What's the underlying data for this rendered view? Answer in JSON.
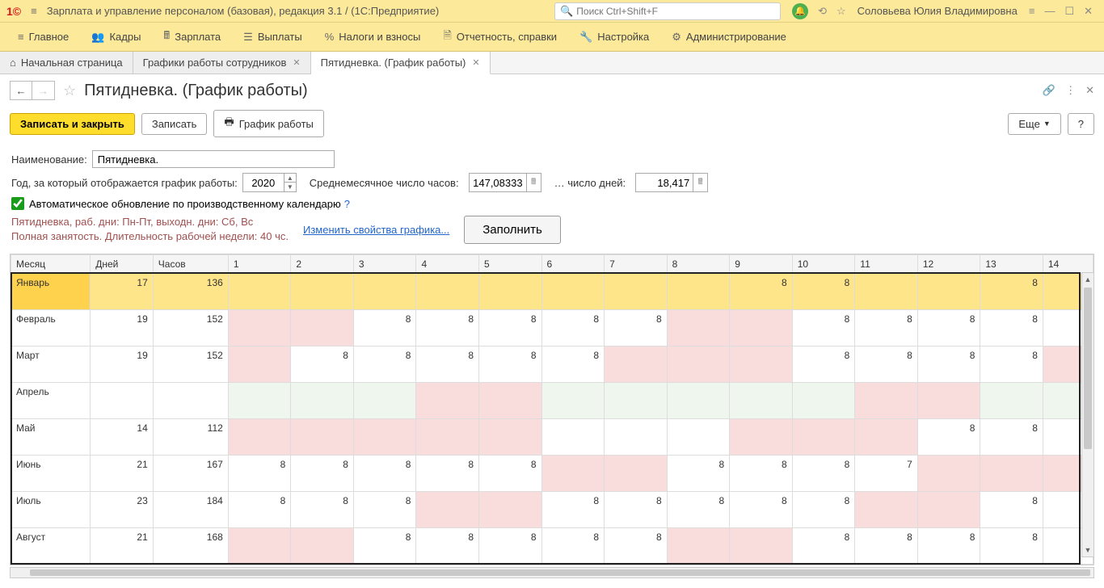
{
  "titlebar": {
    "app_title": "Зарплата и управление персоналом (базовая), редакция 3.1  / (1С:Предприятие)",
    "search_placeholder": "Поиск Ctrl+Shift+F",
    "user": "Соловьева Юлия Владимировна"
  },
  "menu": [
    "Главное",
    "Кадры",
    "Зарплата",
    "Выплаты",
    "Налоги и взносы",
    "Отчетность, справки",
    "Настройка",
    "Администрирование"
  ],
  "tabs": [
    {
      "label": "Начальная страница",
      "closable": false,
      "home": true
    },
    {
      "label": "Графики работы сотрудников",
      "closable": true
    },
    {
      "label": "Пятидневка. (График работы)",
      "closable": true,
      "active": true
    }
  ],
  "page": {
    "title": "Пятидневка. (График работы)",
    "save_close": "Записать и закрыть",
    "save": "Записать",
    "schedule": "График работы",
    "more": "Еще",
    "help": "?",
    "name_label": "Наименование:",
    "name_value": "Пятидневка.",
    "year_label": "Год, за который отображается график работы:",
    "year_value": "2020",
    "avg_hours_label": "Среднемесячное число часов:",
    "avg_hours_value": "147,08333",
    "avg_days_label": "… число дней:",
    "avg_days_value": "18,417",
    "auto_update": "Автоматическое обновление по производственному календарю",
    "info1": "Пятидневка, раб. дни: Пн-Пт, выходн. дни: Сб, Вс",
    "info2": "Полная занятость. Длительность рабочей недели: 40 чс.",
    "change_link": "Изменить свойства графика...",
    "fill": "Заполнить"
  },
  "table": {
    "headers": [
      "Месяц",
      "Дней",
      "Часов",
      "1",
      "2",
      "3",
      "4",
      "5",
      "6",
      "7",
      "8",
      "9",
      "10",
      "11",
      "12",
      "13",
      "14"
    ],
    "rows": [
      {
        "month": "Январь",
        "days": "17",
        "hours": "136",
        "selected": true,
        "cells": [
          {
            "v": "",
            "c": "yel"
          },
          {
            "v": "",
            "c": "yel"
          },
          {
            "v": "",
            "c": "yel"
          },
          {
            "v": "",
            "c": "lightpink"
          },
          {
            "v": "",
            "c": "lightpink"
          },
          {
            "v": "",
            "c": "yel"
          },
          {
            "v": "",
            "c": "yel"
          },
          {
            "v": "",
            "c": "yel"
          },
          {
            "v": "8",
            "c": "yel"
          },
          {
            "v": "8",
            "c": "yel"
          },
          {
            "v": "",
            "c": "lightpink"
          },
          {
            "v": "",
            "c": "lightpink"
          },
          {
            "v": "8",
            "c": "yel"
          },
          {
            "v": "",
            "c": "yel"
          }
        ]
      },
      {
        "month": "Февраль",
        "days": "19",
        "hours": "152",
        "cells": [
          {
            "v": "",
            "c": "pink"
          },
          {
            "v": "",
            "c": "pink"
          },
          {
            "v": "8",
            "c": ""
          },
          {
            "v": "8",
            "c": ""
          },
          {
            "v": "8",
            "c": ""
          },
          {
            "v": "8",
            "c": ""
          },
          {
            "v": "8",
            "c": ""
          },
          {
            "v": "",
            "c": "pink"
          },
          {
            "v": "",
            "c": "pink"
          },
          {
            "v": "8",
            "c": ""
          },
          {
            "v": "8",
            "c": ""
          },
          {
            "v": "8",
            "c": ""
          },
          {
            "v": "8",
            "c": ""
          },
          {
            "v": "",
            "c": ""
          }
        ]
      },
      {
        "month": "Март",
        "days": "19",
        "hours": "152",
        "cells": [
          {
            "v": "",
            "c": "pink"
          },
          {
            "v": "8",
            "c": ""
          },
          {
            "v": "8",
            "c": ""
          },
          {
            "v": "8",
            "c": ""
          },
          {
            "v": "8",
            "c": ""
          },
          {
            "v": "8",
            "c": ""
          },
          {
            "v": "",
            "c": "pink"
          },
          {
            "v": "",
            "c": "pink"
          },
          {
            "v": "",
            "c": "pink"
          },
          {
            "v": "8",
            "c": ""
          },
          {
            "v": "8",
            "c": ""
          },
          {
            "v": "8",
            "c": ""
          },
          {
            "v": "8",
            "c": ""
          },
          {
            "v": "",
            "c": "pink"
          }
        ]
      },
      {
        "month": "Апрель",
        "days": "",
        "hours": "",
        "cells": [
          {
            "v": "",
            "c": "green"
          },
          {
            "v": "",
            "c": "green"
          },
          {
            "v": "",
            "c": "green"
          },
          {
            "v": "",
            "c": "pink"
          },
          {
            "v": "",
            "c": "pink"
          },
          {
            "v": "",
            "c": "green"
          },
          {
            "v": "",
            "c": "green"
          },
          {
            "v": "",
            "c": "green"
          },
          {
            "v": "",
            "c": "green"
          },
          {
            "v": "",
            "c": "green"
          },
          {
            "v": "",
            "c": "pink"
          },
          {
            "v": "",
            "c": "pink"
          },
          {
            "v": "",
            "c": "green"
          },
          {
            "v": "",
            "c": "green"
          }
        ]
      },
      {
        "month": "Май",
        "days": "14",
        "hours": "112",
        "cells": [
          {
            "v": "",
            "c": "pink"
          },
          {
            "v": "",
            "c": "pink"
          },
          {
            "v": "",
            "c": "pink"
          },
          {
            "v": "",
            "c": "pink"
          },
          {
            "v": "",
            "c": "pink"
          },
          {
            "v": "",
            "c": ""
          },
          {
            "v": "",
            "c": ""
          },
          {
            "v": "",
            "c": ""
          },
          {
            "v": "",
            "c": "pink"
          },
          {
            "v": "",
            "c": "pink"
          },
          {
            "v": "",
            "c": "pink"
          },
          {
            "v": "8",
            "c": ""
          },
          {
            "v": "8",
            "c": ""
          },
          {
            "v": "",
            "c": ""
          }
        ]
      },
      {
        "month": "Июнь",
        "days": "21",
        "hours": "167",
        "cells": [
          {
            "v": "8",
            "c": ""
          },
          {
            "v": "8",
            "c": ""
          },
          {
            "v": "8",
            "c": ""
          },
          {
            "v": "8",
            "c": ""
          },
          {
            "v": "8",
            "c": ""
          },
          {
            "v": "",
            "c": "pink"
          },
          {
            "v": "",
            "c": "pink"
          },
          {
            "v": "8",
            "c": ""
          },
          {
            "v": "8",
            "c": ""
          },
          {
            "v": "8",
            "c": ""
          },
          {
            "v": "7",
            "c": ""
          },
          {
            "v": "",
            "c": "pink"
          },
          {
            "v": "",
            "c": "pink"
          },
          {
            "v": "",
            "c": "pink"
          }
        ]
      },
      {
        "month": "Июль",
        "days": "23",
        "hours": "184",
        "cells": [
          {
            "v": "8",
            "c": ""
          },
          {
            "v": "8",
            "c": ""
          },
          {
            "v": "8",
            "c": ""
          },
          {
            "v": "",
            "c": "pink"
          },
          {
            "v": "",
            "c": "pink"
          },
          {
            "v": "8",
            "c": ""
          },
          {
            "v": "8",
            "c": ""
          },
          {
            "v": "8",
            "c": ""
          },
          {
            "v": "8",
            "c": ""
          },
          {
            "v": "8",
            "c": ""
          },
          {
            "v": "",
            "c": "pink"
          },
          {
            "v": "",
            "c": "pink"
          },
          {
            "v": "8",
            "c": ""
          },
          {
            "v": "",
            "c": ""
          }
        ]
      },
      {
        "month": "Август",
        "days": "21",
        "hours": "168",
        "cells": [
          {
            "v": "",
            "c": "pink"
          },
          {
            "v": "",
            "c": "pink"
          },
          {
            "v": "8",
            "c": ""
          },
          {
            "v": "8",
            "c": ""
          },
          {
            "v": "8",
            "c": ""
          },
          {
            "v": "8",
            "c": ""
          },
          {
            "v": "8",
            "c": ""
          },
          {
            "v": "",
            "c": "pink"
          },
          {
            "v": "",
            "c": "pink"
          },
          {
            "v": "8",
            "c": ""
          },
          {
            "v": "8",
            "c": ""
          },
          {
            "v": "8",
            "c": ""
          },
          {
            "v": "8",
            "c": ""
          },
          {
            "v": "",
            "c": ""
          }
        ]
      }
    ]
  }
}
